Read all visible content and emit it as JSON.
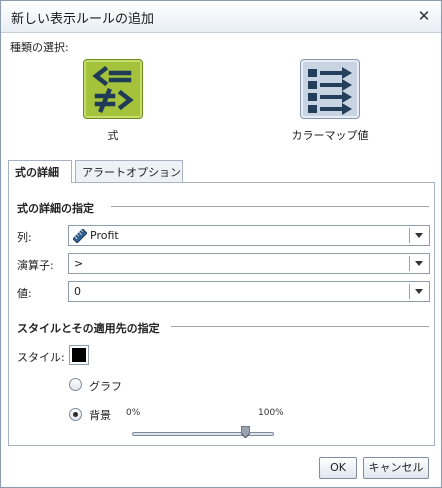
{
  "dialog": {
    "title": "新しい表示ルールの追加",
    "close_glyph": "✕"
  },
  "type_selection": {
    "label": "種類の選択:",
    "options": [
      {
        "label": "式",
        "icon": "formula-icon",
        "selected": true
      },
      {
        "label": "カラーマップ値",
        "icon": "colormap-icon",
        "selected": false
      }
    ]
  },
  "tabs": [
    {
      "label": "式の詳細",
      "active": true
    },
    {
      "label": "アラートオプション",
      "active": false
    }
  ],
  "formula_details": {
    "heading": "式の詳細の指定",
    "column": {
      "label": "列:",
      "value": "Profit",
      "icon": "measure-ruler-icon"
    },
    "operator": {
      "label": "演算子:",
      "value": ">"
    },
    "value": {
      "label": "値:",
      "value": "0"
    }
  },
  "style_section": {
    "heading": "スタイルとその適用先の指定",
    "style_label": "スタイル:",
    "swatch_color": "#000000",
    "apply_options": [
      {
        "label": "グラフ",
        "checked": false
      },
      {
        "label": "背景",
        "checked": true
      }
    ],
    "transparency": {
      "min_label": "0%",
      "max_label": "100%",
      "value": 0.8
    }
  },
  "buttons": {
    "ok": "OK",
    "cancel": "キャンセル"
  },
  "colors": {
    "formula_tile": "#a4c23c",
    "colormap_tile": "#c9d4e2",
    "icon_dark": "#233f5c"
  }
}
